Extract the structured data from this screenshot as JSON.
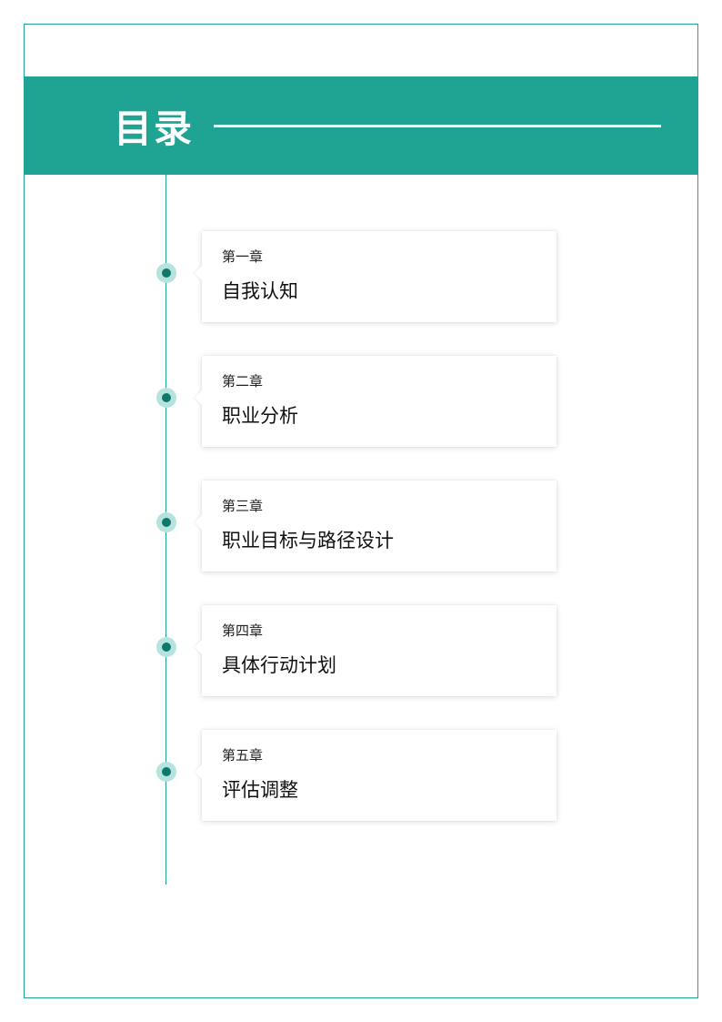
{
  "header": {
    "title": "目录"
  },
  "toc": [
    {
      "label": "第一章",
      "title": "自我认知"
    },
    {
      "label": "第二章",
      "title": "职业分析"
    },
    {
      "label": "第三章",
      "title": "职业目标与路径设计"
    },
    {
      "label": "第四章",
      "title": "具体行动计划"
    },
    {
      "label": "第五章",
      "title": "评估调整"
    }
  ]
}
